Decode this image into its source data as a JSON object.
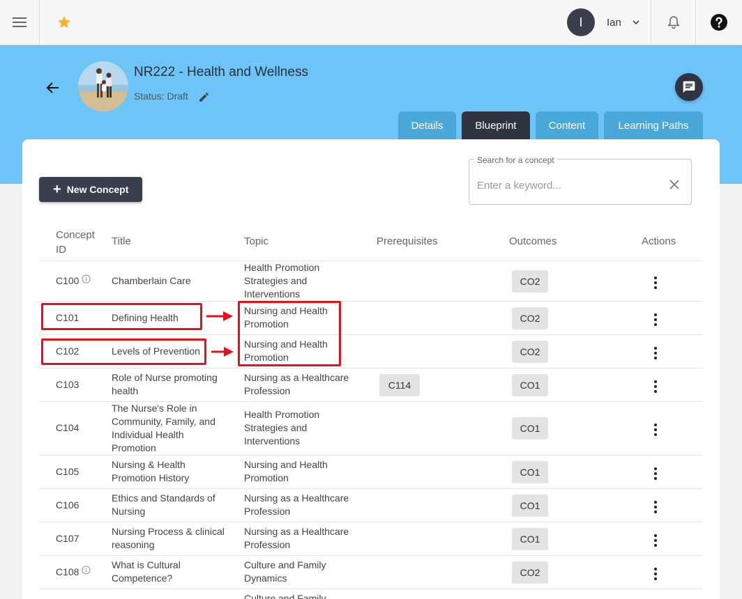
{
  "topbar": {
    "user_initial": "I",
    "user_name": "Ian"
  },
  "course": {
    "title": "NR222 - Health and Wellness",
    "status": "Status: Draft"
  },
  "tabs": [
    {
      "label": "Details"
    },
    {
      "label": "Blueprint"
    },
    {
      "label": "Content"
    },
    {
      "label": "Learning Paths"
    }
  ],
  "toolbar": {
    "new_concept_label": "New Concept"
  },
  "search": {
    "label": "Search for a concept",
    "placeholder": "Enter a keyword..."
  },
  "table": {
    "headers": {
      "concept_id": "Concept ID",
      "title": "Title",
      "topic": "Topic",
      "prerequisites": "Prerequisites",
      "outcomes": "Outcomes",
      "actions": "Actions"
    },
    "rows": [
      {
        "id": "C100",
        "title": "Chamberlain Care",
        "topic": "Health Promotion Strategies and Interventions",
        "prereq": "",
        "outcome": "CO2",
        "info": true
      },
      {
        "id": "C101",
        "title": "Defining Health",
        "topic": "Nursing and Health Promotion",
        "prereq": "",
        "outcome": "CO2",
        "info": false
      },
      {
        "id": "C102",
        "title": "Levels of Prevention",
        "topic": "Nursing and Health Promotion",
        "prereq": "",
        "outcome": "CO2",
        "info": false
      },
      {
        "id": "C103",
        "title": "Role of Nurse promoting health",
        "topic": "Nursing as a Healthcare Profession",
        "prereq": "C114",
        "outcome": "CO1",
        "info": false
      },
      {
        "id": "C104",
        "title": "The Nurse's Role in Community, Family, and Individual Health Promotion",
        "topic": "Health Promotion Strategies and Interventions",
        "prereq": "",
        "outcome": "CO1",
        "info": false
      },
      {
        "id": "C105",
        "title": "Nursing & Health Promotion History",
        "topic": "Nursing and Health Promotion",
        "prereq": "",
        "outcome": "CO1",
        "info": false
      },
      {
        "id": "C106",
        "title": "Ethics and Standards of Nursing",
        "topic": "Nursing as a Healthcare Profession",
        "prereq": "",
        "outcome": "CO1",
        "info": false
      },
      {
        "id": "C107",
        "title": "Nursing Process & clinical reasoning",
        "topic": "Nursing as a Healthcare Profession",
        "prereq": "",
        "outcome": "CO1",
        "info": false
      },
      {
        "id": "C108",
        "title": "What is Cultural Competence?",
        "topic": "Culture and Family Dynamics",
        "prereq": "",
        "outcome": "CO2",
        "info": true
      },
      {
        "id": "",
        "title": "",
        "topic": "Culture and Family",
        "prereq": "",
        "outcome": "",
        "info": false
      }
    ]
  },
  "colors": {
    "header_blue": "#6cc4f7",
    "tab_blue": "#4aa7d9",
    "dark": "#2f3441",
    "annotation_red": "#e8101a",
    "star": "#f5b32b"
  }
}
